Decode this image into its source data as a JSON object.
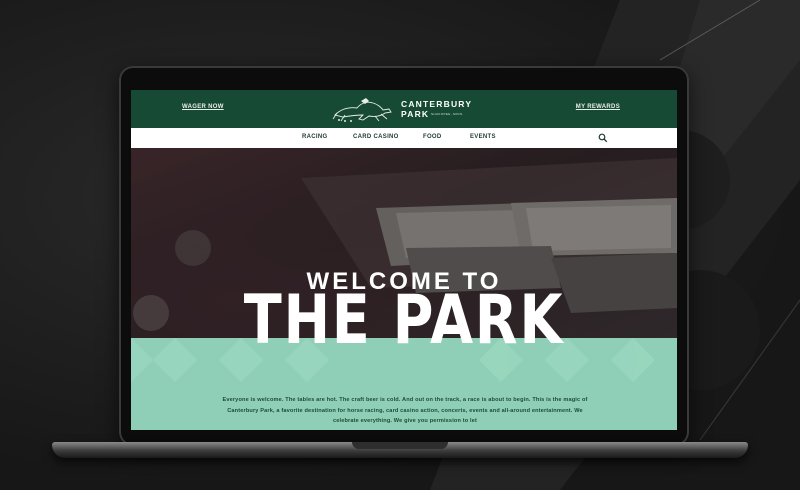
{
  "header": {
    "left_link": "WAGER NOW",
    "right_link": "MY REWARDS",
    "logo_line1": "CANTERBURY",
    "logo_line2": "PARK",
    "logo_location": "SHAKOPEE, MINN."
  },
  "nav": {
    "items": [
      "RACING",
      "CARD CASINO",
      "FOOD",
      "EVENTS"
    ],
    "search_icon": "search-icon"
  },
  "hero": {
    "line1": "WELCOME TO",
    "line2": "THE PARK"
  },
  "intro": {
    "text": "Everyone is welcome. The tables are hot. The craft beer is cold. And out on the track, a race is about to begin. This is the magic of Canterbury Park, a favorite destination for horse racing, card casino action, concerts, events and all-around entertainment. We celebrate everything. We give you permission to let"
  },
  "colors": {
    "header_green": "#174a34",
    "mint": "#8fcfb7",
    "text_green": "#1b4c36"
  }
}
